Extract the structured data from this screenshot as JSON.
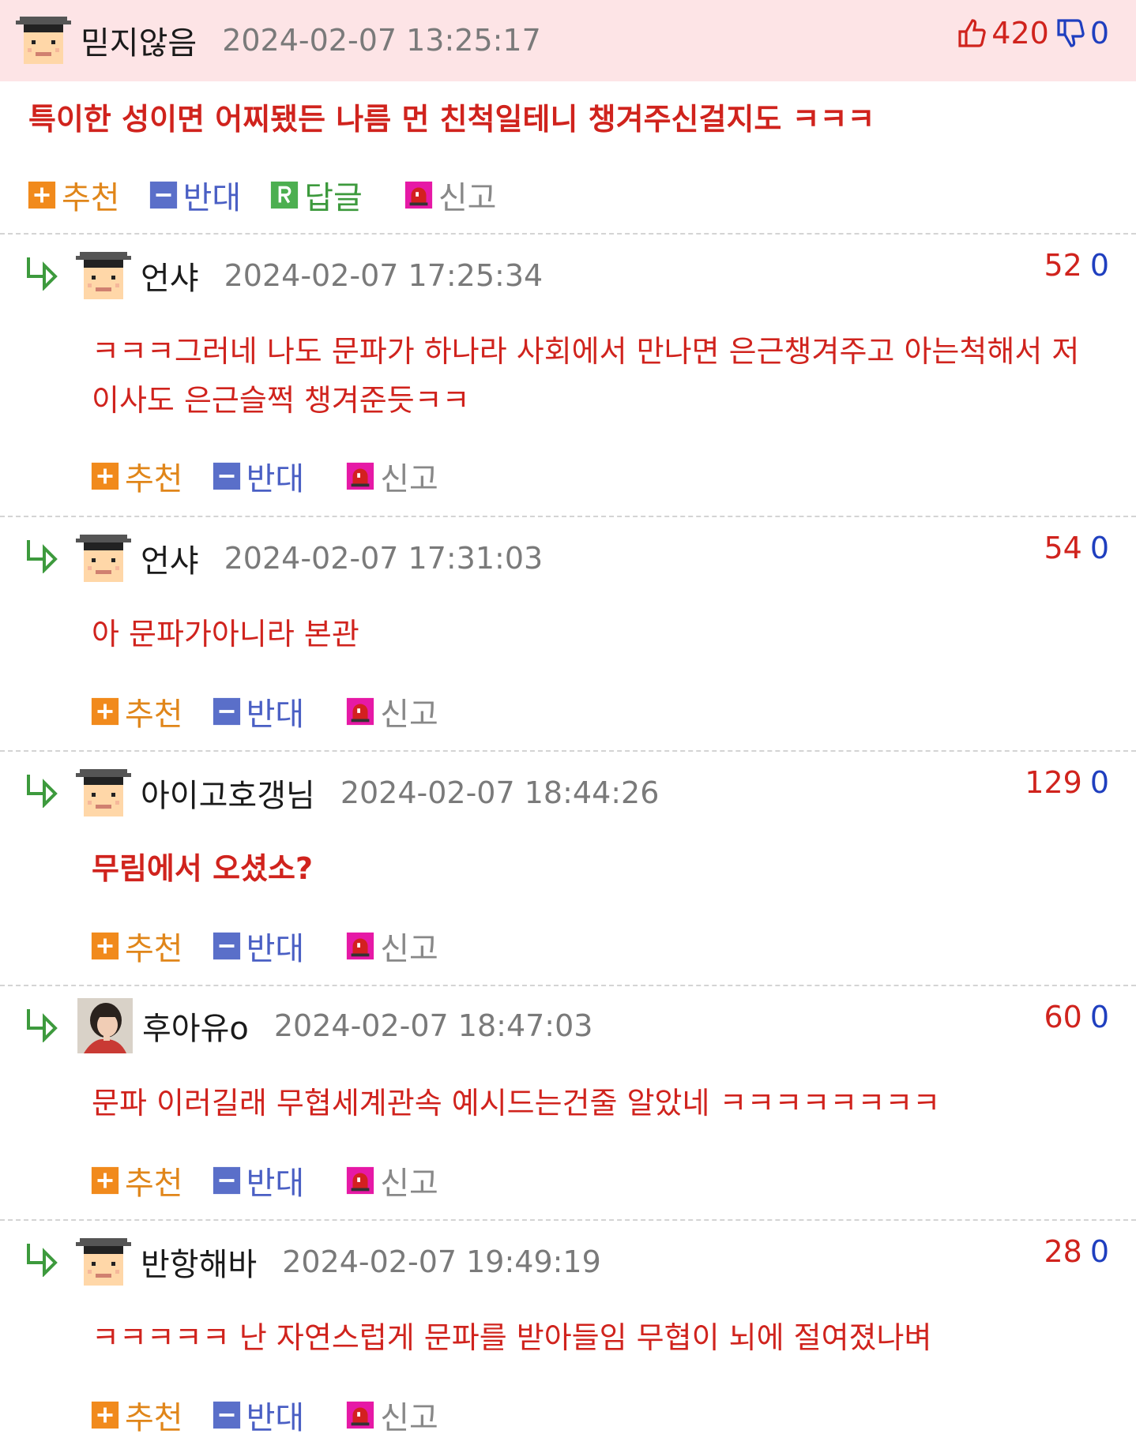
{
  "icons": {
    "avatar_default": "graduate-avatar-icon",
    "avatar_photo": "profile-photo-avatar",
    "reply_arrow": "reply-arrow-icon",
    "recommend": "plus-icon",
    "oppose": "minus-icon",
    "reply": "r-icon",
    "report": "siren-icon",
    "thumb_up": "thumbs-up-icon",
    "thumb_down": "thumbs-down-icon"
  },
  "colors": {
    "highlight_bg": "#fde4e6",
    "comment_text": "#d0231d",
    "up_count": "#d0231d",
    "down_count": "#1f3fbf",
    "recommend": "#e0861a",
    "oppose": "#4a5fc4",
    "reply": "#3d9a3d",
    "report": "#888888"
  },
  "actions": {
    "recommend": "추천",
    "oppose": "반대",
    "reply": "답글",
    "report": "신고"
  },
  "comments": [
    {
      "nick": "믿지않음",
      "date": "2024-02-07 13:25:17",
      "up": "420",
      "down": "0",
      "lines": [
        "특이한 성이면 어찌됐든 나름 먼 친척일테니 챙겨주신걸지도 ㅋㅋㅋ"
      ]
    },
    {
      "nick": "언샤",
      "date": "2024-02-07 17:25:34",
      "up": "52",
      "down": "0",
      "lines": [
        "ㅋㅋㅋ그러네 나도 문파가 하나라 사회에서 만나면 은근챙겨주고 아는척해서 저",
        "이사도 은근슬쩍 챙겨준듯ㅋㅋ"
      ]
    },
    {
      "nick": "언샤",
      "date": "2024-02-07 17:31:03",
      "up": "54",
      "down": "0",
      "lines": [
        "아 문파가아니라 본관"
      ]
    },
    {
      "nick": "아이고호갱님",
      "date": "2024-02-07 18:44:26",
      "up": "129",
      "down": "0",
      "lines": [
        "무림에서 오셨소?"
      ]
    },
    {
      "nick": "후아유o",
      "date": "2024-02-07 18:47:03",
      "up": "60",
      "down": "0",
      "lines": [
        "문파 이러길래 무협세계관속 예시드는건줄 알았네 ㅋㅋㅋㅋㅋㅋㅋㅋ"
      ]
    },
    {
      "nick": "반항해바",
      "date": "2024-02-07 19:49:19",
      "up": "28",
      "down": "0",
      "lines": [
        "ㅋㅋㅋㅋㅋ 난 자연스럽게 문파를 받아들임 무협이 뇌에 절여졌나벼"
      ]
    }
  ]
}
